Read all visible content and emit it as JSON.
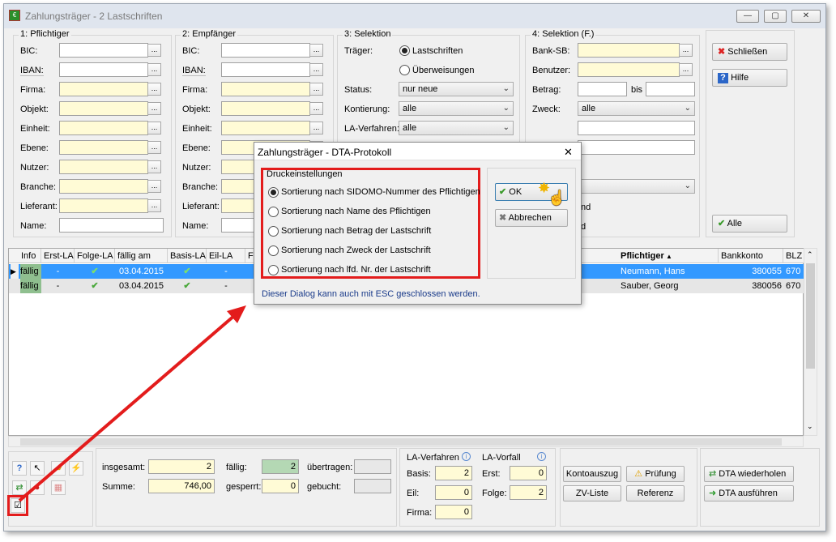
{
  "window": {
    "title": "Zahlungsträger - 2 Lastschriften",
    "min_label": "—",
    "max_label": "▢",
    "close_label": "✕"
  },
  "pflichtiger": {
    "title": "1: Pflichtiger",
    "fields": [
      {
        "label": "BIC:",
        "value": "",
        "yellow": false,
        "button": true
      },
      {
        "label": "IBAN:",
        "value": "",
        "yellow": false,
        "button": true
      },
      {
        "label": "Firma:",
        "value": "",
        "yellow": true,
        "button": true
      },
      {
        "label": "Objekt:",
        "value": "",
        "yellow": true,
        "button": true
      },
      {
        "label": "Einheit:",
        "value": "",
        "yellow": true,
        "button": true
      },
      {
        "label": "Ebene:",
        "value": "",
        "yellow": true,
        "button": true
      },
      {
        "label": "Nutzer:",
        "value": "",
        "yellow": true,
        "button": true
      },
      {
        "label": "Branche:",
        "value": "",
        "yellow": true,
        "button": true
      },
      {
        "label": "Lieferant:",
        "value": "",
        "yellow": true,
        "button": true
      },
      {
        "label": "Name:",
        "value": "",
        "yellow": false,
        "button": false
      }
    ]
  },
  "empfaenger": {
    "title": "2: Empfänger",
    "fields": [
      {
        "label": "BIC:",
        "yellow": false
      },
      {
        "label": "IBAN:",
        "yellow": false
      },
      {
        "label": "Firma:",
        "yellow": true
      },
      {
        "label": "Objekt:",
        "yellow": true
      },
      {
        "label": "Einheit:",
        "yellow": true
      },
      {
        "label": "Ebene:",
        "yellow": true
      },
      {
        "label": "Nutzer:",
        "yellow": true
      },
      {
        "label": "Branche:",
        "yellow": true
      },
      {
        "label": "Lieferant:",
        "yellow": true
      },
      {
        "label": "Name:",
        "yellow": false
      }
    ]
  },
  "selektion": {
    "title": "3: Selektion",
    "traeger_label": "Träger:",
    "radio_lastschriften": "Lastschriften",
    "radio_ueberweisungen": "Überweisungen",
    "status_label": "Status:",
    "status_value": "nur neue",
    "kontierung_label": "Kontierung:",
    "kontierung_value": "alle",
    "laverfahren_label": "LA-Verfahren:",
    "laverfahren_value": "alle"
  },
  "selektion_f": {
    "title": "4: Selektion (F.)",
    "banksb_label": "Bank-SB:",
    "benutzer_label": "Benutzer:",
    "betrag_label": "Betrag:",
    "bis_label": "bis",
    "zweck_label": "Zweck:",
    "zweck_value": "alle",
    "partial_nd_1": "nd",
    "partial_nd_2": "d"
  },
  "side_buttons": {
    "schliessen": "Schließen",
    "hilfe": "Hilfe",
    "alle": "Alle"
  },
  "table": {
    "headers_left": [
      "Info",
      "Erst-LA",
      "Folge-LA",
      "fällig am",
      "Basis-LA",
      "Eil-LA",
      "Fi"
    ],
    "headers_right": [
      "Pflichtiger",
      "Bankkonto",
      "BLZ"
    ],
    "rows": [
      {
        "info": "fällig",
        "erst": "-",
        "folge": "✔",
        "faellig": "03.04.2015",
        "basis": "✔",
        "eil": "-",
        "pflichtiger": "Neumann, Hans",
        "konto": "380055",
        "blz": "670"
      },
      {
        "info": "fällig",
        "erst": "-",
        "folge": "✔",
        "faellig": "03.04.2015",
        "basis": "✔",
        "eil": "-",
        "pflichtiger": "Sauber, Georg",
        "konto": "380056",
        "blz": "670"
      }
    ]
  },
  "summary": {
    "insgesamt_label": "insgesamt:",
    "insgesamt_value": "2",
    "summe_label": "Summe:",
    "summe_value": "746,00",
    "faellig_label": "fällig:",
    "faellig_value": "2",
    "gesperrt_label": "gesperrt:",
    "gesperrt_value": "0",
    "uebertragen_label": "übertragen:",
    "uebertragen_value": "",
    "gebucht_label": "gebucht:",
    "gebucht_value": ""
  },
  "la_stats": {
    "verfahren_title": "LA-Verfahren",
    "vorfall_title": "LA-Vorfall",
    "basis_label": "Basis:",
    "basis_value": "2",
    "eil_label": "Eil:",
    "eil_value": "0",
    "firma_label": "Firma:",
    "firma_value": "0",
    "erst_label": "Erst:",
    "erst_value": "0",
    "folge_label": "Folge:",
    "folge_value": "2"
  },
  "bottom_buttons": {
    "kontoauszug": "Kontoauszug",
    "pruefung": "Prüfung",
    "zvliste": "ZV-Liste",
    "referenz": "Referenz",
    "dta_wiederholen": "DTA wiederholen",
    "dta_ausfuehren": "DTA ausführen"
  },
  "dialog": {
    "title": "Zahlungsträger - DTA-Protokoll",
    "close_label": "✕",
    "group_title": "Druckeinstellungen",
    "options": [
      "Sortierung nach SIDOMO-Nummer des Pflichtigen",
      "Sortierung nach Name des Pflichtigen",
      "Sortierung nach Betrag der Lastschrift",
      "Sortierung nach Zweck der Lastschrift",
      "Sortierung nach lfd. Nr. der Lastschrift"
    ],
    "selected_index": 0,
    "ok_label": "OK",
    "cancel_label": "Abbrechen",
    "hint": "Dieser Dialog kann auch mit ESC geschlossen werden."
  },
  "colors": {
    "highlight": "#e31c1c",
    "selection": "#3399ff",
    "yellow_field": "#fffbd6"
  }
}
